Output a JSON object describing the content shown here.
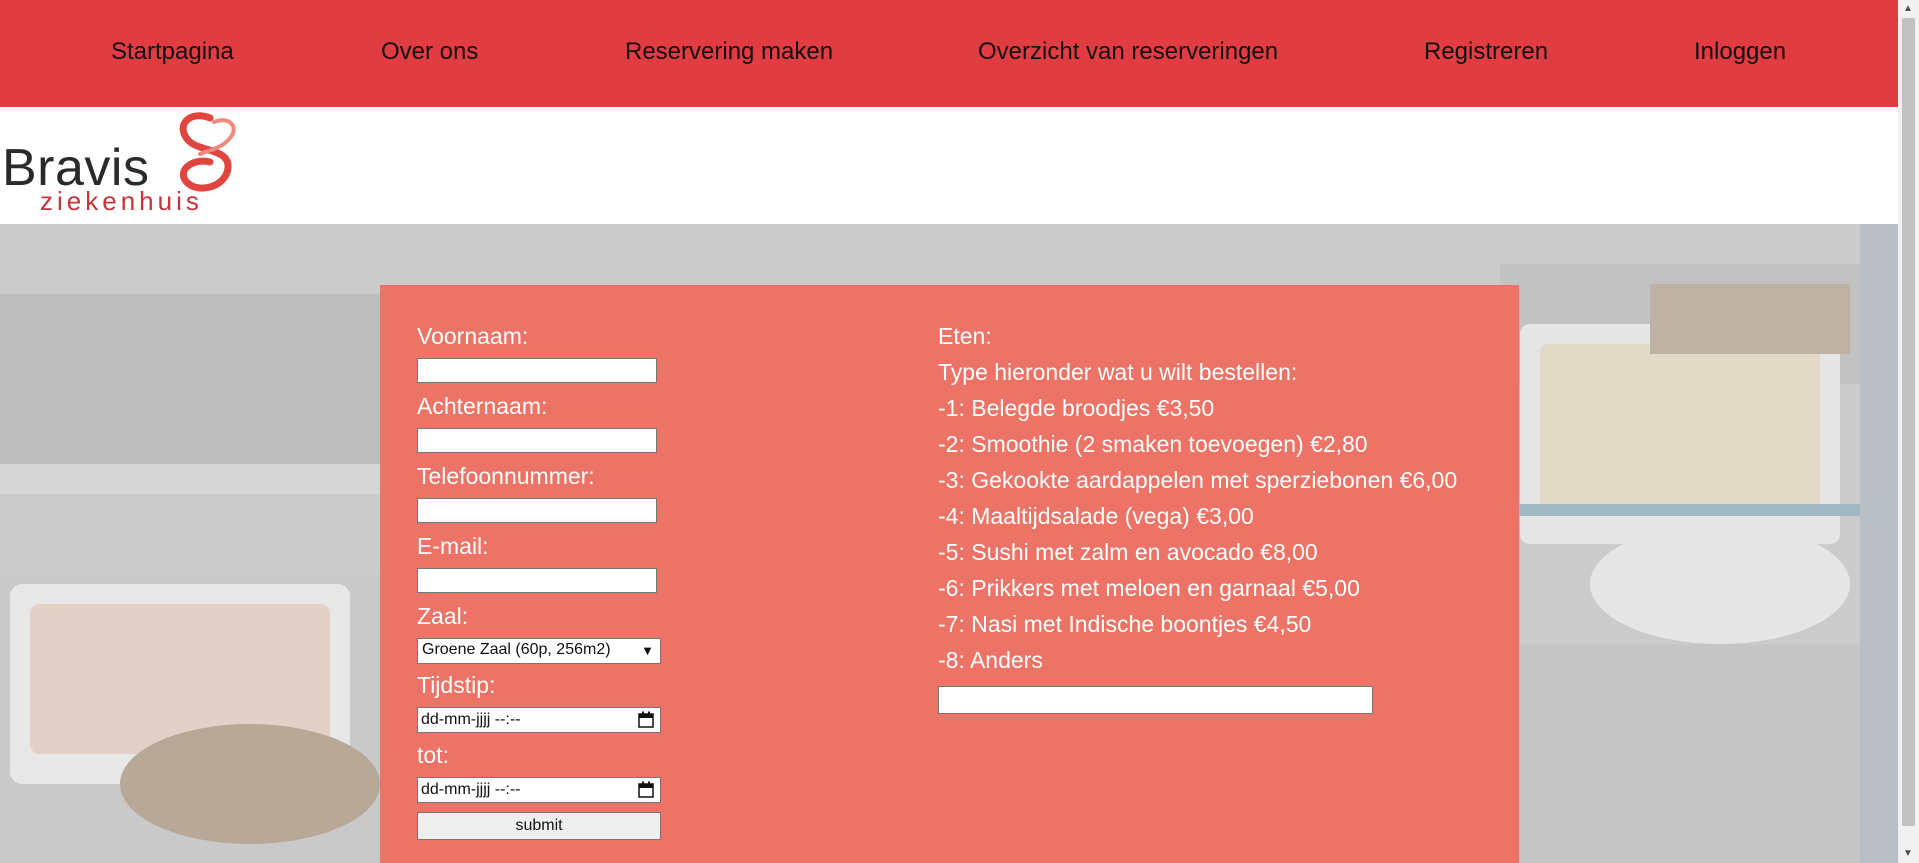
{
  "nav": {
    "items": [
      {
        "label": "Startpagina"
      },
      {
        "label": "Over ons"
      },
      {
        "label": "Reservering maken"
      },
      {
        "label": "Overzicht van reserveringen"
      },
      {
        "label": "Registreren"
      },
      {
        "label": "Inloggen"
      }
    ]
  },
  "logo": {
    "name": "Bravis",
    "subtitle": "ziekenhuis",
    "brand_color": "#c7333a"
  },
  "colors": {
    "nav_bg": "#e13c42",
    "panel_bg": "#ec7365"
  },
  "form": {
    "firstname_label": "Voornaam:",
    "lastname_label": "Achternaam:",
    "phone_label": "Telefoonnummer:",
    "email_label": "E-mail:",
    "room_label": "Zaal:",
    "room_selected": "Groene Zaal (60p, 256m2)",
    "time_label": "Tijdstip:",
    "time_placeholder": "dd-mm-jjjj --:--",
    "until_label": "tot:",
    "until_placeholder": "dd-mm-jjjj --:--",
    "submit_label": "submit"
  },
  "food": {
    "title": "Eten:",
    "instruction": "Type hieronder wat u wilt bestellen:",
    "items": [
      "-1: Belegde broodjes €3,50",
      "-2: Smoothie (2 smaken toevoegen) €2,80",
      "-3: Gekookte aardappelen met sperziebonen €6,00",
      "-4: Maaltijdsalade (vega) €3,00",
      "-5: Sushi met zalm en avocado €8,00",
      "-6: Prikkers met meloen en garnaal €5,00",
      "-7: Nasi met Indische boontjes €4,50",
      "-8: Anders"
    ]
  }
}
